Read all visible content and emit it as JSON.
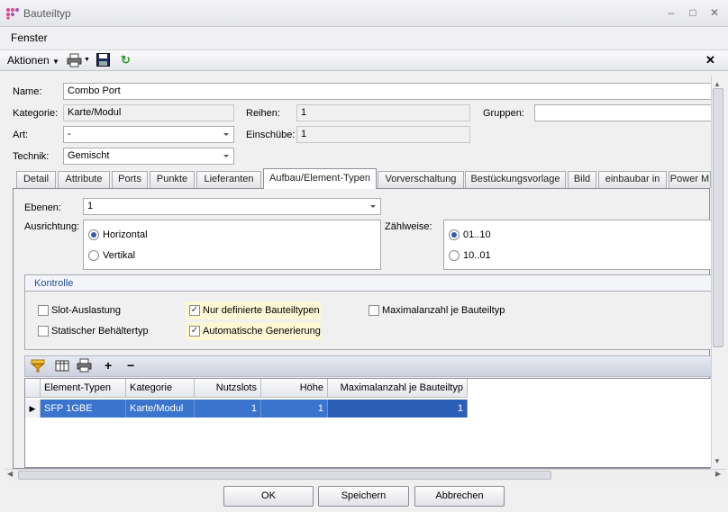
{
  "window": {
    "title": "Bauteiltyp"
  },
  "menu": {
    "fenster": "Fenster"
  },
  "toolbar": {
    "aktionen": "Aktionen",
    "close": "✕"
  },
  "form": {
    "name_label": "Name:",
    "name_value": "Combo Port",
    "kategorie_label": "Kategorie:",
    "kategorie_value": "Karte/Modul",
    "reihen_label": "Reihen:",
    "reihen_value": "1",
    "gruppen_label": "Gruppen:",
    "gruppen_value": "",
    "art_label": "Art:",
    "art_value": "-",
    "einschuebe_label": "Einschübe:",
    "einschuebe_value": "1",
    "technik_label": "Technik:",
    "technik_value": "Gemischt"
  },
  "tabs": [
    "Detail",
    "Attribute",
    "Ports",
    "Punkte",
    "Lieferanten",
    "Aufbau/Element-Typen",
    "Vorverschaltung",
    "Bestückungsvorlage",
    "Bild",
    "einbaubar in",
    "Power M"
  ],
  "aufbau": {
    "ebenen_label": "Ebenen:",
    "ebenen_value": "1",
    "ausrichtung_label": "Ausrichtung:",
    "horizontal": "Horizontal",
    "vertikal": "Vertikal",
    "zaehlweise_label": "Zählweise:",
    "z1": "01..10",
    "z2": "10..01"
  },
  "kontrolle": {
    "title": "Kontrolle",
    "slot": "Slot-Auslastung",
    "statisch": "Statischer Behältertyp",
    "nur_definierte": "Nur definierte Bauteiltypen",
    "automatische": "Automatische Generierung",
    "maximalanzahl": "Maximalanzahl je Bauteiltyp"
  },
  "grid": {
    "toolbar": {
      "add": "+",
      "remove": "−"
    },
    "headers": [
      "Element-Typen",
      "Kategorie",
      "Nutzslots",
      "Höhe",
      "Maximalanzahl je Bauteiltyp"
    ],
    "rows": [
      [
        "SFP 1GBE",
        "Karte/Modul",
        "1",
        "1",
        "1"
      ]
    ]
  },
  "buttons": {
    "ok": "OK",
    "speichern": "Speichern",
    "abbrechen": "Abbrechen"
  },
  "colors": {
    "selection": "#3a74cc",
    "window_bg": "#f0f0f0"
  }
}
